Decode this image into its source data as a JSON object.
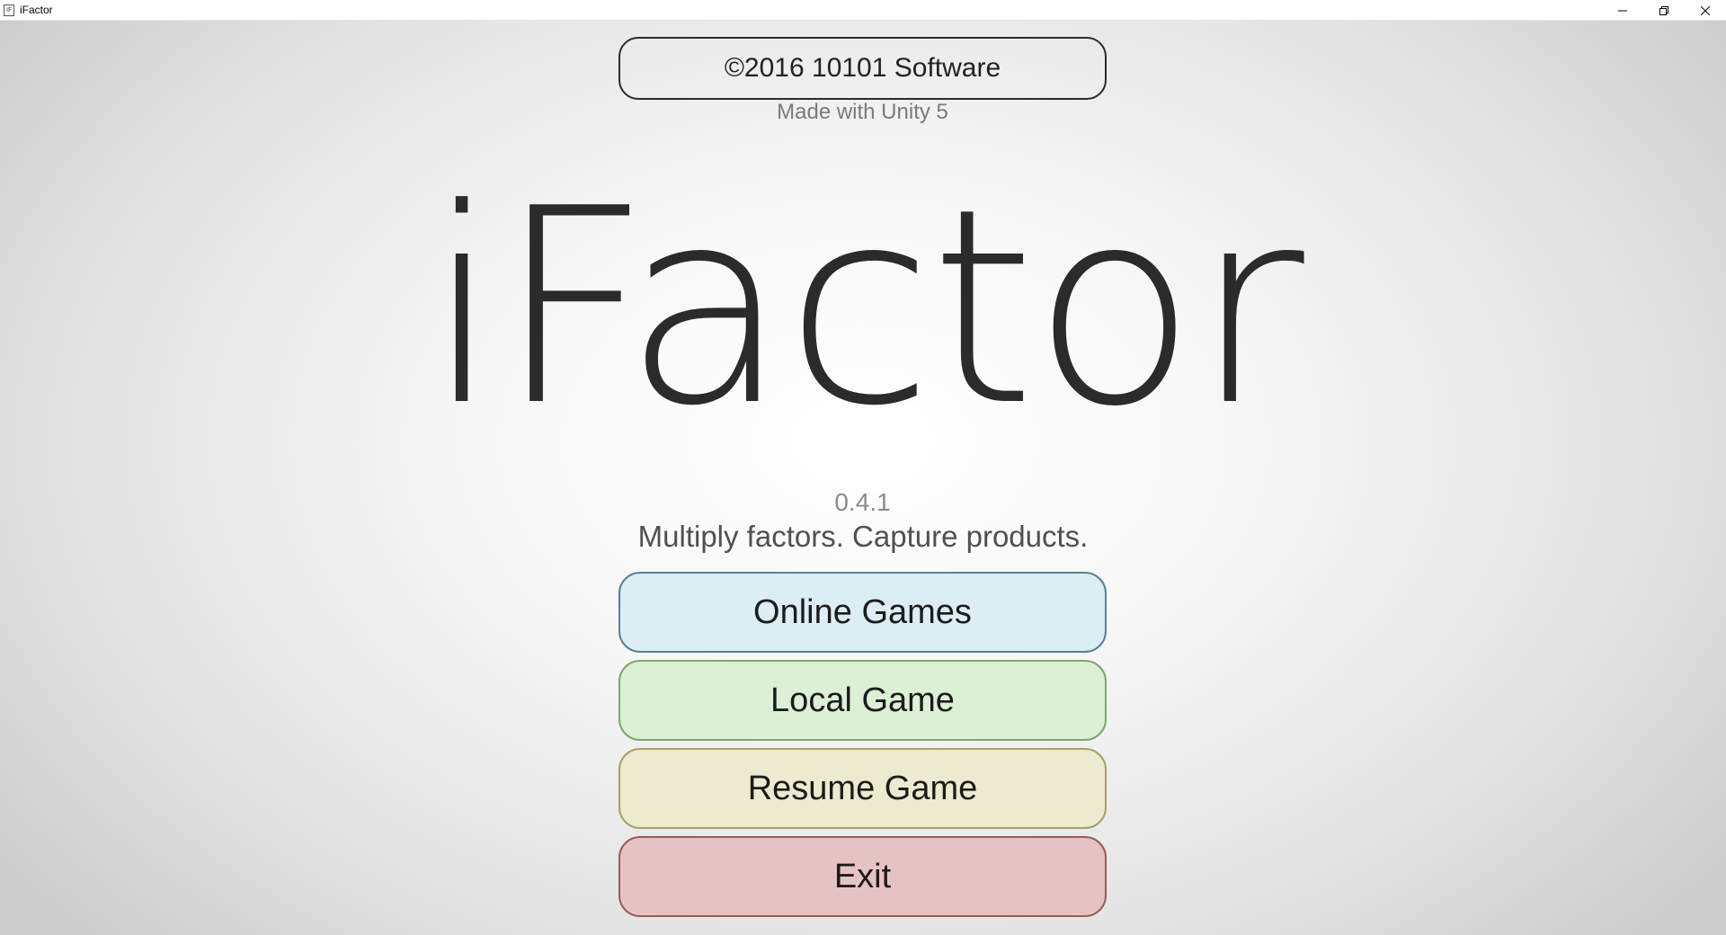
{
  "window": {
    "title": "iFactor",
    "icon_glyph": "iF"
  },
  "menu": {
    "copyright": "©2016 10101 Software",
    "made_with": "Made with Unity 5",
    "logo": "iFactor",
    "version": "0.4.1",
    "tagline": "Multiply factors. Capture products.",
    "buttons": [
      {
        "label": "Online Games",
        "fill": "#dcedf4",
        "border": "#5b7f93"
      },
      {
        "label": "Local Game",
        "fill": "#dcf0d6",
        "border": "#7ea66e"
      },
      {
        "label": "Resume Game",
        "fill": "#ecebcf",
        "border": "#a6a06a"
      },
      {
        "label": "Exit",
        "fill": "#e6c3c3",
        "border": "#9a5a5a"
      }
    ]
  },
  "icons": {
    "minimize": "minimize-icon",
    "restore": "restore-icon",
    "close": "close-icon"
  }
}
